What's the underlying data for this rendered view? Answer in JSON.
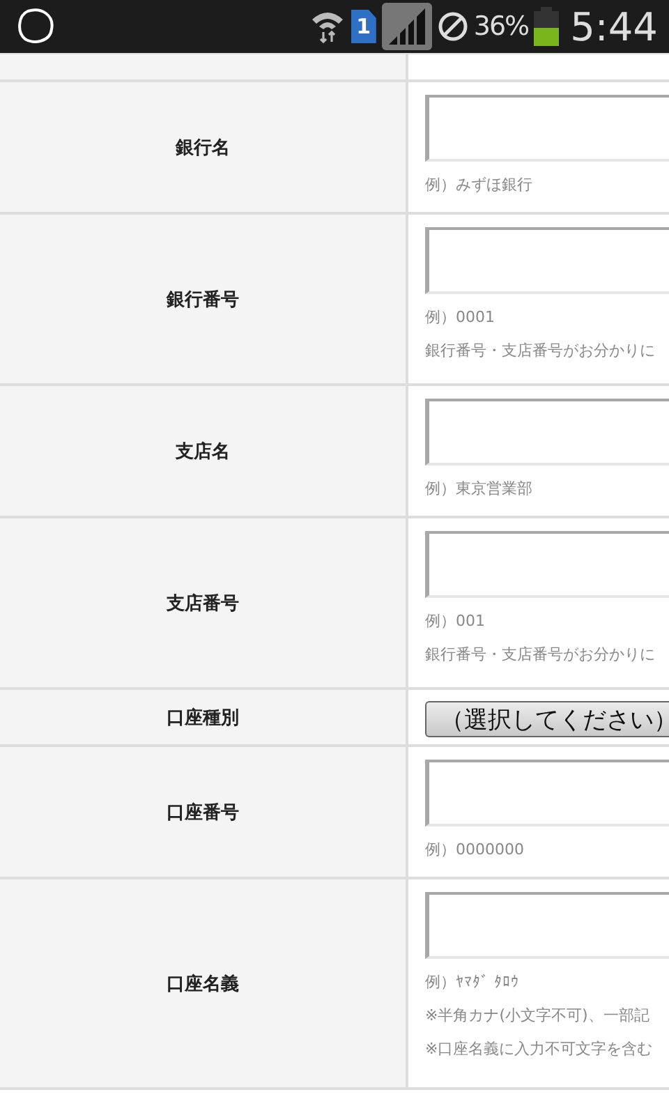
{
  "status_bar": {
    "sim_slot": "1",
    "battery_percent": "36%",
    "time": "5:44"
  },
  "form_rows": [
    {
      "kind": "input",
      "label": "銀行名",
      "hints": [
        "例）みずほ銀行"
      ]
    },
    {
      "kind": "input",
      "label": "銀行番号",
      "hints": [
        "例）0001",
        "銀行番号・支店番号がお分かりに"
      ]
    },
    {
      "kind": "input",
      "label": "支店名",
      "hints": [
        "例）東京営業部"
      ]
    },
    {
      "kind": "input",
      "label": "支店番号",
      "hints": [
        "例）001",
        "銀行番号・支店番号がお分かりに"
      ]
    },
    {
      "kind": "select",
      "label": "口座種別",
      "button": "（選択してください）"
    },
    {
      "kind": "input",
      "label": "口座番号",
      "hints": [
        "例）0000000"
      ]
    },
    {
      "kind": "input",
      "label": "口座名義",
      "hints": [
        "例）ﾔﾏﾀﾞ ﾀﾛｳ",
        "※半角カナ(小文字不可)、一部記",
        "※口座名義に入力不可文字を含む"
      ]
    }
  ]
}
